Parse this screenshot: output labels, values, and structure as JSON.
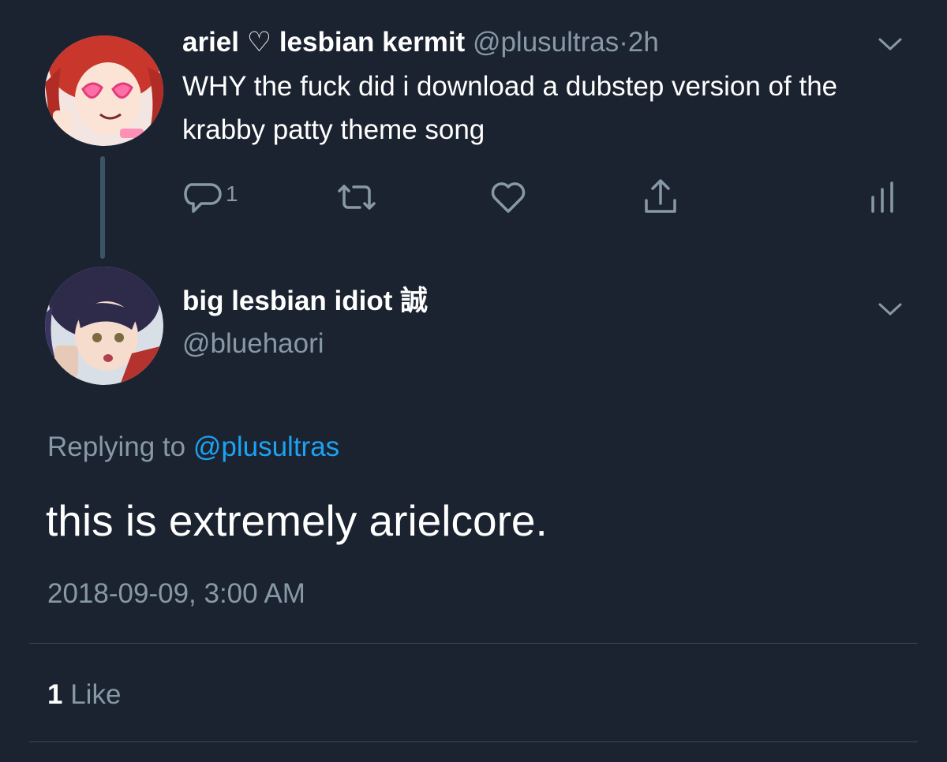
{
  "original_tweet": {
    "display_name": "ariel ♡ lesbian kermit",
    "handle": "@plusultras",
    "separator": "·",
    "time_ago": "2h",
    "text": "WHY the fuck did i download a dubstep version of the krabby patty theme song",
    "reply_count": "1",
    "icons": [
      "reply-icon",
      "retweet-icon",
      "like-icon",
      "share-icon",
      "analytics-icon",
      "chevron-down-icon"
    ]
  },
  "reply_tweet": {
    "display_name": "big lesbian idiot 誠",
    "handle": "@bluehaori",
    "replying_label": "Replying to",
    "replying_to": "@plusultras",
    "text": "this is extremely arielcore.",
    "timestamp": "2018-09-09, 3:00 AM",
    "like_count": "1",
    "like_label": "Like"
  },
  "colors": {
    "background": "#1b2330",
    "text_primary": "#ffffff",
    "text_secondary": "#8899a6",
    "link": "#1da1f2",
    "thread_line": "#3d5466",
    "divider": "#3d4a57"
  }
}
